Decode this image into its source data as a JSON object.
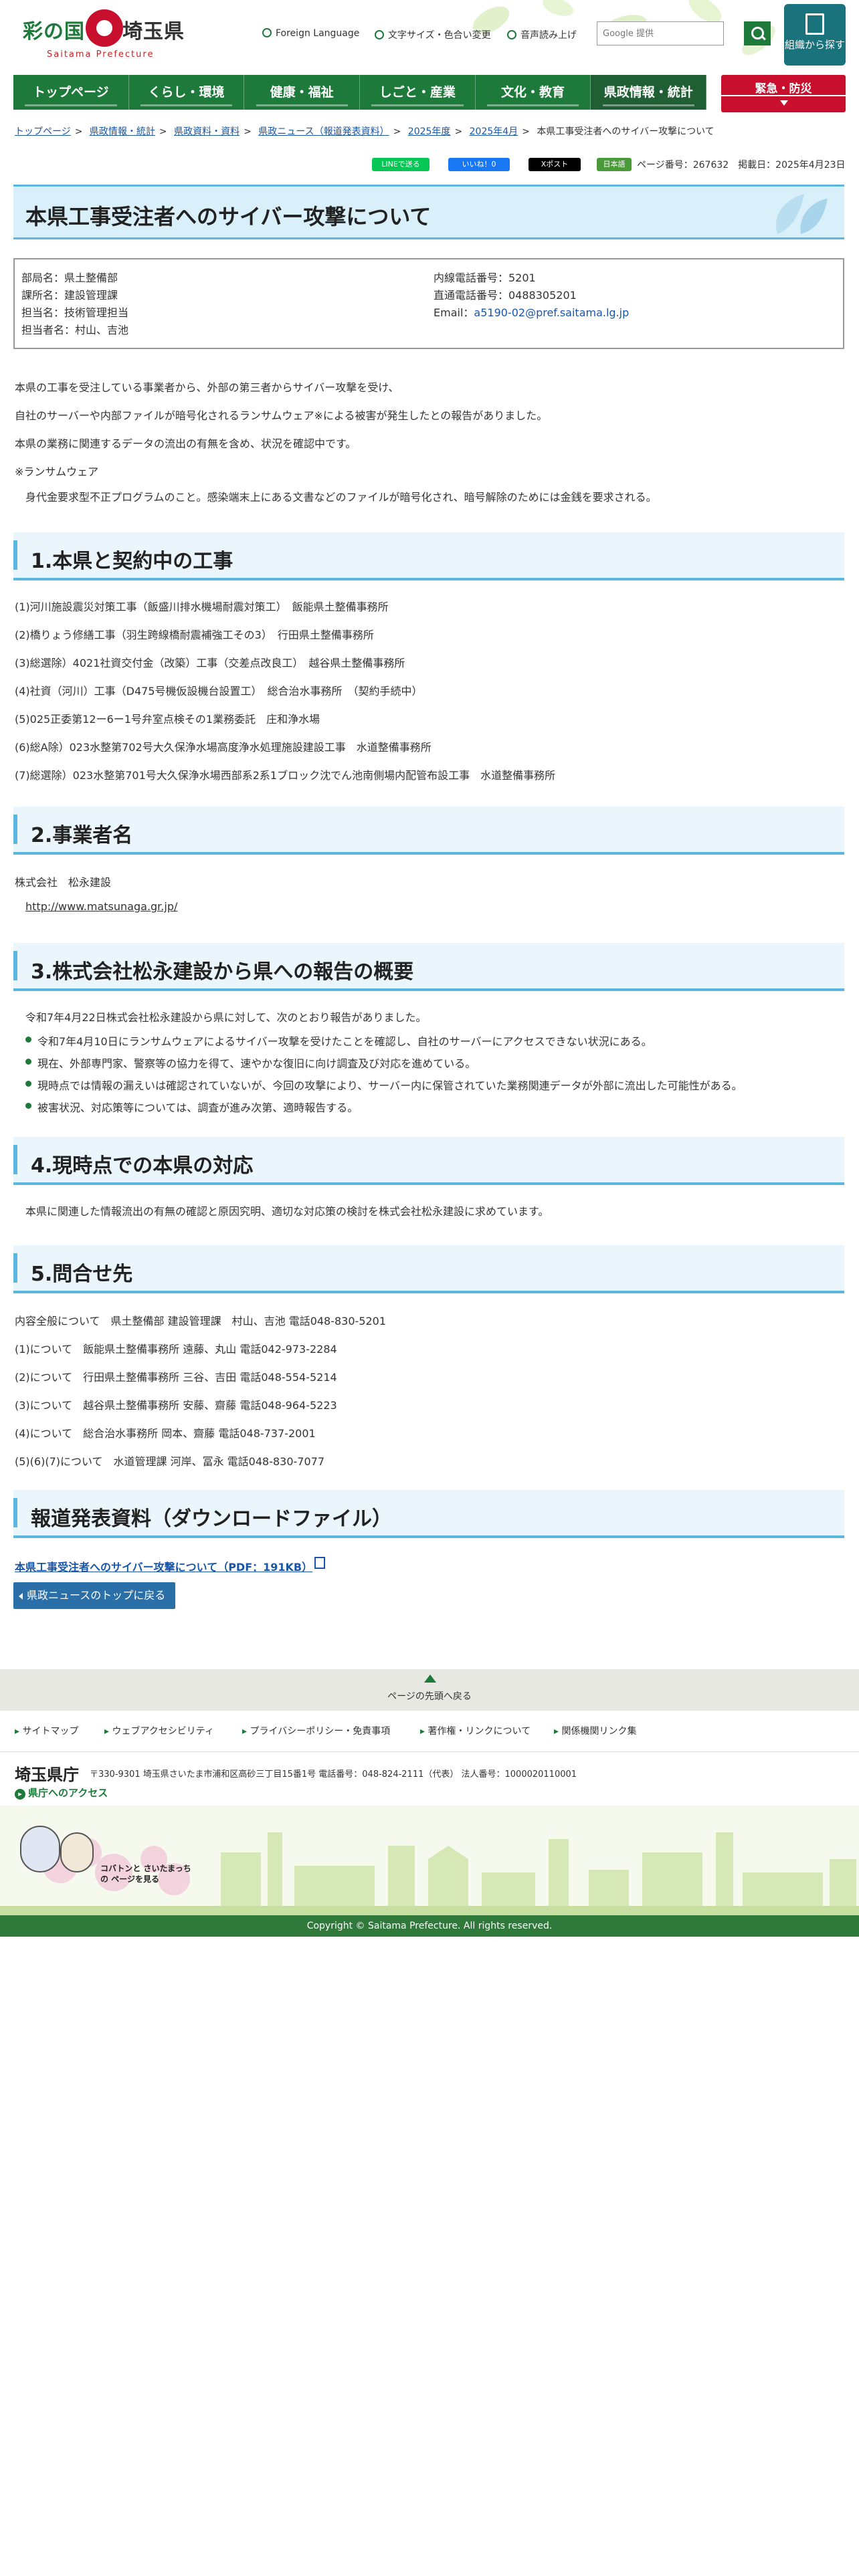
{
  "header": {
    "logo_brand": "彩の国",
    "logo_pref": "埼玉県",
    "logo_sub": "Saitama Prefecture",
    "foreign_language": "Foreign Language",
    "text_size_color": "文字サイズ・色合い変更",
    "read_aloud": "音声読み上げ",
    "search_placeholder": "Google 提供",
    "org_search": "組織から探す"
  },
  "nav": [
    "トップページ",
    "くらし・環境",
    "健康・福祉",
    "しごと・産業",
    "文化・教育",
    "県政情報・統計"
  ],
  "emergency": "緊急・防災",
  "breadcrumbs": [
    "トップページ",
    "県政情報・統計",
    "県政資料・資料",
    "県政ニュース（報道発表資料）",
    "2025年度",
    "2025年4月",
    "本県工事受注者へのサイバー攻撃について"
  ],
  "share": {
    "line": "LINEで送る",
    "facebook": "いいね！0",
    "x": "Xポスト",
    "other": "日本語"
  },
  "page_meta": "ページ番号：267632　掲載日：2025年4月23日",
  "title": "本県工事受注者へのサイバー攻撃について",
  "contact": {
    "dept": "部局名：県土整備部",
    "section": "課所名：建設管理課",
    "team": "担当名：技術管理担当",
    "person": "担当者名：村山、吉池",
    "ext": "内線電話番号：5201",
    "direct": "直通電話番号：0488305201",
    "email_label": "Email：",
    "email": "a5190-02@pref.saitama.lg.jp"
  },
  "intro": [
    "本県の工事を受注している事業者から、外部の第三者からサイバー攻撃を受け、",
    "自社のサーバーや内部ファイルが暗号化されるランサムウェア※による被害が発生したとの報告がありました。",
    "本県の業務に関連するデータの流出の有無を含め、状況を確認中です。",
    "※ランサムウェア",
    "身代金要求型不正プログラムのこと。感染端末上にある文書などのファイルが暗号化され、暗号解除のためには金銭を要求される。"
  ],
  "sections": {
    "s1": "1.本県と契約中の工事",
    "s2": "2.事業者名",
    "s3": "3.株式会社松永建設から県への報告の概要",
    "s4": "4.現時点での本県の対応",
    "s5": "5.問合せ先",
    "s6": "報道発表資料（ダウンロードファイル）"
  },
  "works": [
    "(1)河川施設震災対策工事（飯盛川排水機場耐震対策工）　飯能県土整備事務所",
    "(2)橋りょう修繕工事（羽生跨線橋耐震補強工その3）　行田県土整備事務所",
    "(3)総選除）4021社資交付金（改築）工事（交差点改良工）　越谷県土整備事務所",
    "(4)社資（河川）工事（D475号機仮設機台設置工）　総合治水事務所　（契約手続中）",
    "(5)025正委第12ー6ー1号弁室点検その1業務委託　庄和浄水場",
    "(6)総A除）023水整第702号大久保浄水場高度浄水処理施設建設工事　水道整備事務所",
    "(7)総選除）023水整第701号大久保浄水場西部系2系1ブロック沈でん池南側場内配管布設工事　水道整備事務所"
  ],
  "company": {
    "name": "株式会社　松永建設",
    "url": "http://www.matsunaga.gr.jp/"
  },
  "report": {
    "lead": "令和7年4月22日株式会社松永建設から県に対して、次のとおり報告がありました。",
    "items": [
      "令和7年4月10日にランサムウェアによるサイバー攻撃を受けたことを確認し、自社のサーバーにアクセスできない状況にある。",
      "現在、外部専門家、警察等の協力を得て、速やかな復旧に向け調査及び対応を進めている。",
      "現時点では情報の漏えいは確認されていないが、今回の攻撃により、サーバー内に保管されていた業務関連データが外部に流出した可能性がある。",
      "被害状況、対応策等については、調査が進み次第、適時報告する。"
    ]
  },
  "response": "本県に関連した情報流出の有無の確認と原因究明、適切な対応策の検討を株式会社松永建設に求めています。",
  "inquiries": [
    "内容全般について　県土整備部 建設管理課　村山、吉池 電話048-830-5201",
    "(1)について　飯能県土整備事務所 遠藤、丸山 電話042-973-2284",
    "(2)について　行田県土整備事務所 三谷、吉田 電話048-554-5214",
    "(3)について　越谷県土整備事務所 安藤、齋藤 電話048-964-5223",
    "(4)について　総合治水事務所 岡本、齋藤 電話048-737-2001",
    "(5)(6)(7)について　水道管理課 河岸、冨永 電話048-830-7077"
  ],
  "download_link": "本県工事受注者へのサイバー攻撃について（PDF：191KB）",
  "back_button": "県政ニュースのトップに戻る",
  "footer": {
    "to_top": "ページの先頭へ戻る",
    "links": [
      "サイトマップ",
      "ウェブアクセシビリティ",
      "プライバシーポリシー・免責事項",
      "著作権・リンクについて",
      "関係機関リンク集"
    ],
    "name": "埼玉県庁",
    "address": "〒330-9301 埼玉県さいたま市浦和区高砂三丁目15番1号 電話番号：048-824-2111（代表） 法人番号：1000020110001",
    "access": "県庁へのアクセス",
    "mascot_text": "コバトンと さいたまっちの ページを見る",
    "copyright": "Copyright © Saitama Prefecture. All rights reserved."
  },
  "colors": {
    "brand_green": "#1d7a3a",
    "emergency_red": "#c8102e",
    "heading_blue": "#5bb7dd",
    "link_blue": "#1a56a8"
  }
}
